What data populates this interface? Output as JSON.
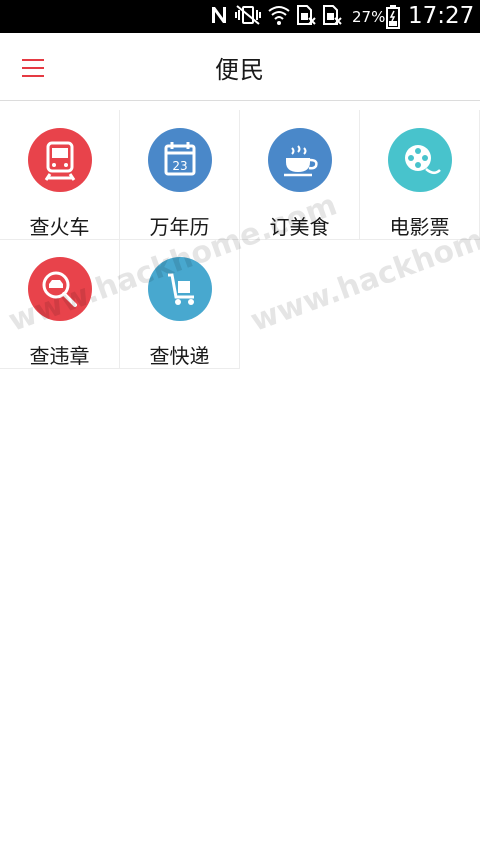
{
  "status_bar": {
    "battery_percent": "27%",
    "time": "17:27",
    "icons": [
      "n-icon",
      "vibrate-mute-icon",
      "wifi-icon",
      "sim-no-signal-icon",
      "sim-no-signal-icon",
      "battery-icon"
    ]
  },
  "app_bar": {
    "title": "便民",
    "menu_icon": "hamburger-menu-icon",
    "accent_color": "#e53a43"
  },
  "tiles": [
    {
      "label": "查火车",
      "icon": "train-icon",
      "color": "#e8434b"
    },
    {
      "label": "万年历",
      "icon": "calendar-icon",
      "color": "#4a88c9",
      "icon_text": "23"
    },
    {
      "label": "订美食",
      "icon": "coffee-cup-icon",
      "color": "#4a88c9"
    },
    {
      "label": "电影票",
      "icon": "film-reel-icon",
      "color": "#48c3cc"
    },
    {
      "label": "查违章",
      "icon": "car-magnifier-icon",
      "color": "#e8434b"
    },
    {
      "label": "查快递",
      "icon": "delivery-cart-icon",
      "color": "#48a8cf"
    }
  ],
  "watermark": "www.hackhome.com"
}
